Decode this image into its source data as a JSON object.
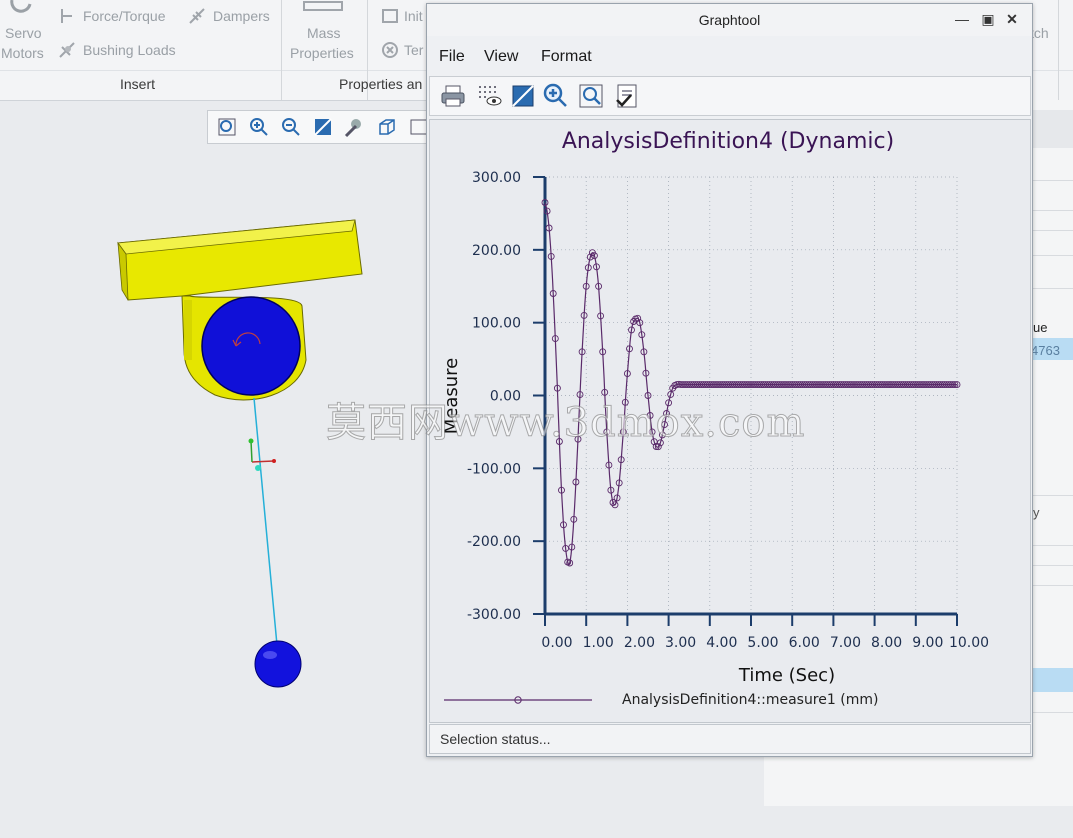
{
  "ribbon": {
    "servo_motors_line1": "Servo",
    "servo_motors_line2": "Motors",
    "force_torque": "Force/Torque",
    "dampers": "Dampers",
    "bushing_loads": "Bushing Loads",
    "mass_properties_line1": "Mass",
    "mass_properties_line2": "Properties",
    "initial": "Init",
    "terminate": "Ter",
    "match": "tch",
    "group_insert": "Insert",
    "group_properties": "Properties an"
  },
  "right_panel": {
    "value_header": "ue",
    "value_cell": "4763",
    "collapsed_label": "y"
  },
  "watermark": "莫西网www.3dmox.com",
  "graphtool": {
    "title": "Graphtool",
    "menu": [
      "File",
      "View",
      "Format"
    ],
    "toolbar_icons": [
      "print-icon",
      "grid-eye-icon",
      "zoom-fit-icon",
      "zoom-in-icon",
      "zoom-window-icon",
      "checklist-icon"
    ],
    "status": "Selection status..."
  },
  "colors": {
    "series": "#5a2a6a",
    "axis": "#1c3d6b",
    "ball": "#1010d8",
    "body": "#e5e500"
  },
  "chart_data": {
    "type": "line",
    "title": "AnalysisDefinition4 (Dynamic)",
    "xlabel": "Time (Sec)",
    "ylabel": "Measure",
    "xlim": [
      0,
      10
    ],
    "ylim": [
      -300,
      300
    ],
    "x_ticks": [
      "0.00",
      "1.00",
      "2.00",
      "3.00",
      "4.00",
      "5.00",
      "6.00",
      "7.00",
      "8.00",
      "9.00",
      "10.00"
    ],
    "y_ticks": [
      "300.00",
      "200.00",
      "100.00",
      "0.00",
      "-100.00",
      "-200.00",
      "-300.00"
    ],
    "grid": true,
    "legend": "bottom",
    "series": [
      {
        "name": "AnalysisDefinition4::measure1 (mm)",
        "x": [
          0.0,
          0.1,
          0.2,
          0.3,
          0.4,
          0.5,
          0.6,
          0.7,
          0.8,
          0.9,
          1.0,
          1.1,
          1.2,
          1.3,
          1.4,
          1.5,
          1.6,
          1.7,
          1.8,
          1.9,
          2.0,
          2.1,
          2.2,
          2.3,
          2.4,
          2.5,
          2.6,
          2.7,
          2.8,
          2.9,
          3.0,
          3.1,
          3.2,
          3.3,
          3.4,
          3.5,
          3.6,
          3.7,
          4.0,
          5.0,
          6.0,
          7.0,
          8.0,
          9.0,
          10.0
        ],
        "y": [
          265,
          230,
          140,
          10,
          -130,
          -210,
          -230,
          -170,
          -60,
          60,
          150,
          190,
          192,
          150,
          60,
          -50,
          -130,
          -150,
          -120,
          -50,
          30,
          90,
          105,
          100,
          60,
          0,
          -50,
          -70,
          -65,
          -40,
          -10,
          10,
          15,
          15,
          15,
          15,
          15,
          15,
          15,
          15,
          15,
          15,
          15,
          15,
          15
        ]
      }
    ]
  }
}
